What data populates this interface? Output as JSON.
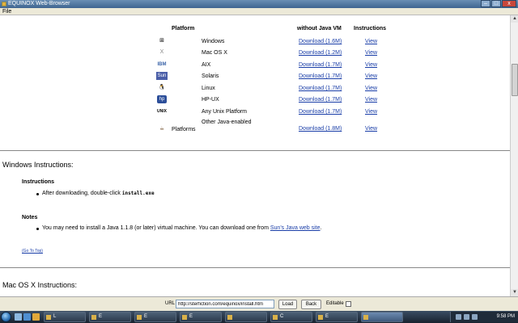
{
  "window": {
    "title": "EQUINOX Web-Browser",
    "buttons": [
      "–",
      "□",
      "x"
    ]
  },
  "menu": {
    "file": "File"
  },
  "table": {
    "headers": {
      "platform": "Platform",
      "download": "without Java VM",
      "instructions": "Instructions"
    },
    "rows": [
      {
        "icon": "windows-icon",
        "glyph": "⊞",
        "name": "Windows",
        "download": "Download (1.6M)",
        "view": "View"
      },
      {
        "icon": "mac-os-x-icon",
        "glyph": "X",
        "name": "Mac OS X",
        "download": "Download (1.2M)",
        "view": "View"
      },
      {
        "icon": "ibm-icon",
        "glyph": "IBM",
        "name": "AIX",
        "download": "Download (1.7M)",
        "view": "View"
      },
      {
        "icon": "sun-icon",
        "glyph": "Sun",
        "name": "Solaris",
        "download": "Download (1.7M)",
        "view": "View"
      },
      {
        "icon": "linux-tux-icon",
        "glyph": "🐧",
        "name": "Linux",
        "download": "Download (1.7M)",
        "view": "View"
      },
      {
        "icon": "hp-icon",
        "glyph": "hp",
        "name": "HP-UX",
        "download": "Download (1.7M)",
        "view": "View"
      },
      {
        "icon": "unix-icon",
        "glyph": "UNIX",
        "name": "Any Unix Platform",
        "download": "Download (1.7M)",
        "view": "View"
      },
      {
        "icon": "java-icon",
        "glyph": "☕",
        "name_line1": "Other Java-enabled",
        "name_line2": "Platforms",
        "download": "Download (1.8M)",
        "view": "View"
      }
    ]
  },
  "windows_section": {
    "heading": "Windows Instructions:",
    "instructions_heading": "Instructions",
    "instruction_prefix": "After downloading, double-click",
    "instruction_file": "install.exe",
    "notes_heading": "Notes",
    "note_text": "You may need to install a Java 1.1.8 (or later) virtual machine. You can download one from",
    "note_link": "Sun's Java web site",
    "note_end": ".",
    "top_link": "(Go To Top)"
  },
  "mac_section": {
    "heading": "Mac OS X Instructions:"
  },
  "urlbar": {
    "label": "URL",
    "value": "http://sterfiction.com/equinox/install.htm",
    "load": "Load",
    "back": "Back",
    "editable_label": "Editable"
  },
  "taskbar": {
    "clock": "9:58 PM",
    "items": [
      "L",
      "E",
      "E",
      "E",
      "",
      "C",
      "E"
    ]
  }
}
